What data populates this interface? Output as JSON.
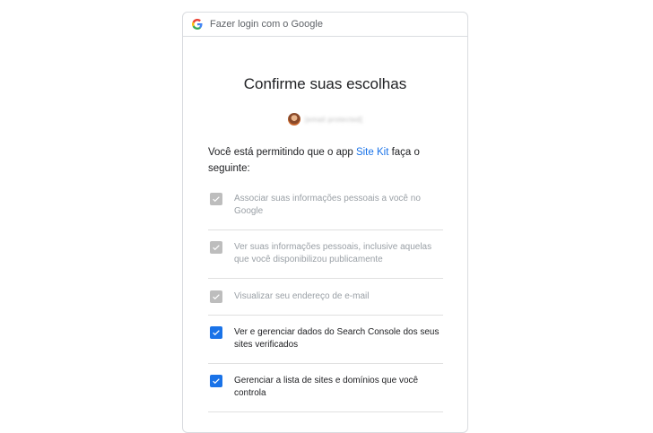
{
  "header": {
    "title": "Fazer login com o Google",
    "logo_icon": "google-g-icon"
  },
  "main": {
    "title": "Confirme suas escolhas",
    "account_email": "[email protected]",
    "intro_prefix": "Você está permitindo que o app ",
    "app_name": "Site Kit",
    "intro_suffix": " faça o seguinte:"
  },
  "permissions": [
    {
      "label": "Associar suas informações pessoais a você no Google",
      "checked": true,
      "enabled": false
    },
    {
      "label": "Ver suas informações pessoais, inclusive aquelas que você disponibilizou publicamente",
      "checked": true,
      "enabled": false
    },
    {
      "label": "Visualizar seu endereço de e-mail",
      "checked": true,
      "enabled": false
    },
    {
      "label": "Ver e gerenciar dados do Search Console dos seus sites verificados",
      "checked": true,
      "enabled": true
    },
    {
      "label": "Gerenciar a lista de sites e domínios que você controla",
      "checked": true,
      "enabled": true
    }
  ],
  "colors": {
    "accent": "#1a73e8",
    "disabled_checkbox": "#bdbdbd",
    "divider": "#e0e0e0"
  }
}
